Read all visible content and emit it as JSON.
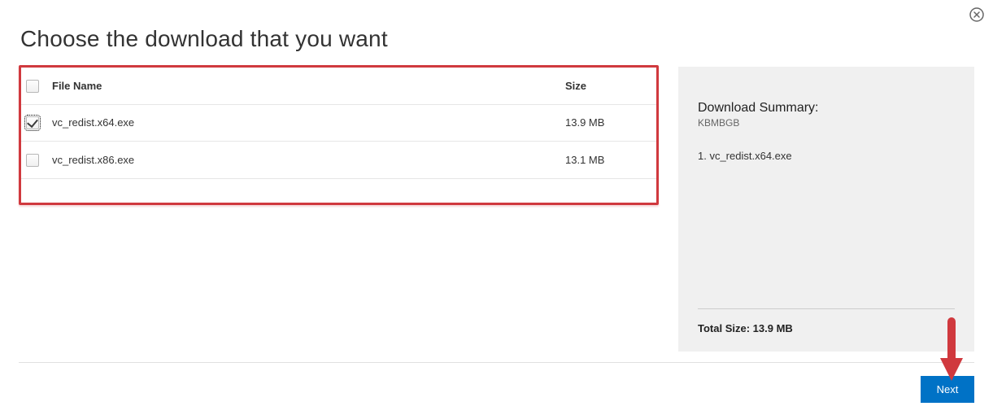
{
  "header": {
    "title": "Choose the download that you want"
  },
  "table": {
    "headers": {
      "file_name": "File Name",
      "size": "Size"
    },
    "rows": [
      {
        "name": "vc_redist.x64.exe",
        "size": "13.9 MB",
        "checked": true,
        "focused": true
      },
      {
        "name": "vc_redist.x86.exe",
        "size": "13.1 MB",
        "checked": false,
        "focused": false
      }
    ]
  },
  "summary": {
    "title": "Download Summary:",
    "units": "KBMBGB",
    "items": [
      "1. vc_redist.x64.exe"
    ],
    "total_label": "Total Size: 13.9 MB"
  },
  "actions": {
    "next_label": "Next"
  },
  "annotation": {
    "highlight_color": "#d0393e",
    "arrow_color": "#d0393e"
  }
}
